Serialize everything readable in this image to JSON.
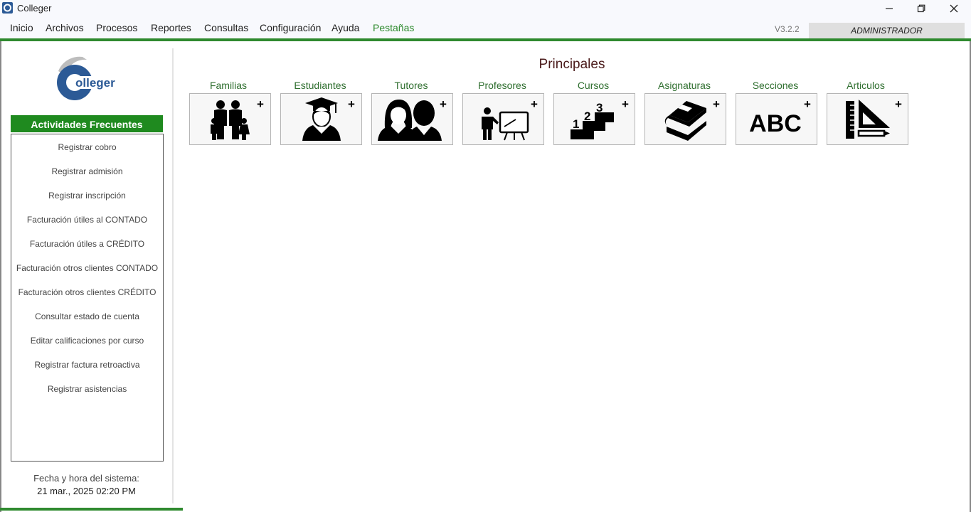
{
  "window": {
    "title": "Colleger",
    "version": "V3.2.2",
    "user": "ADMINISTRADOR"
  },
  "menu": [
    "Inicio",
    "Archivos",
    "Procesos",
    "Reportes",
    "Consultas",
    "Configuración",
    "Ayuda",
    "Pestañas"
  ],
  "logo": {
    "text": "olleger"
  },
  "sidebar": {
    "header": "Actividades Frecuentes",
    "items": [
      "Registrar cobro",
      "Registrar admisión",
      "Registrar inscripción",
      "Facturación útiles al CONTADO",
      "Facturación útiles a CRÉDITO",
      "Facturación otros clientes CONTADO",
      "Facturación otros clientes CRÉDITO",
      "Consultar estado de cuenta",
      "Editar calificaciones por curso",
      "Registrar factura retroactiva",
      "Registrar asistencias"
    ],
    "datetime_label": "Fecha y hora del sistema:",
    "datetime_value": "21 mar., 2025  02:20 PM"
  },
  "main": {
    "title": "Principales",
    "tiles": [
      {
        "label": "Familias",
        "icon": "family-icon"
      },
      {
        "label": "Estudiantes",
        "icon": "graduate-icon"
      },
      {
        "label": "Tutores",
        "icon": "tutors-icon"
      },
      {
        "label": "Profesores",
        "icon": "teacher-icon"
      },
      {
        "label": "Cursos",
        "icon": "stairs-123-icon"
      },
      {
        "label": "Asignaturas",
        "icon": "books-icon"
      },
      {
        "label": "Secciones",
        "icon": "abc-icon"
      },
      {
        "label": "Articulos",
        "icon": "ruler-square-icon"
      }
    ],
    "tile_plus": "+",
    "abc_text": "ABC"
  },
  "colors": {
    "accent_green": "#2f8a2f",
    "header_green": "#1f8a1f",
    "title_brown": "#4a1a1a",
    "logo_blue": "#2c5a96"
  }
}
